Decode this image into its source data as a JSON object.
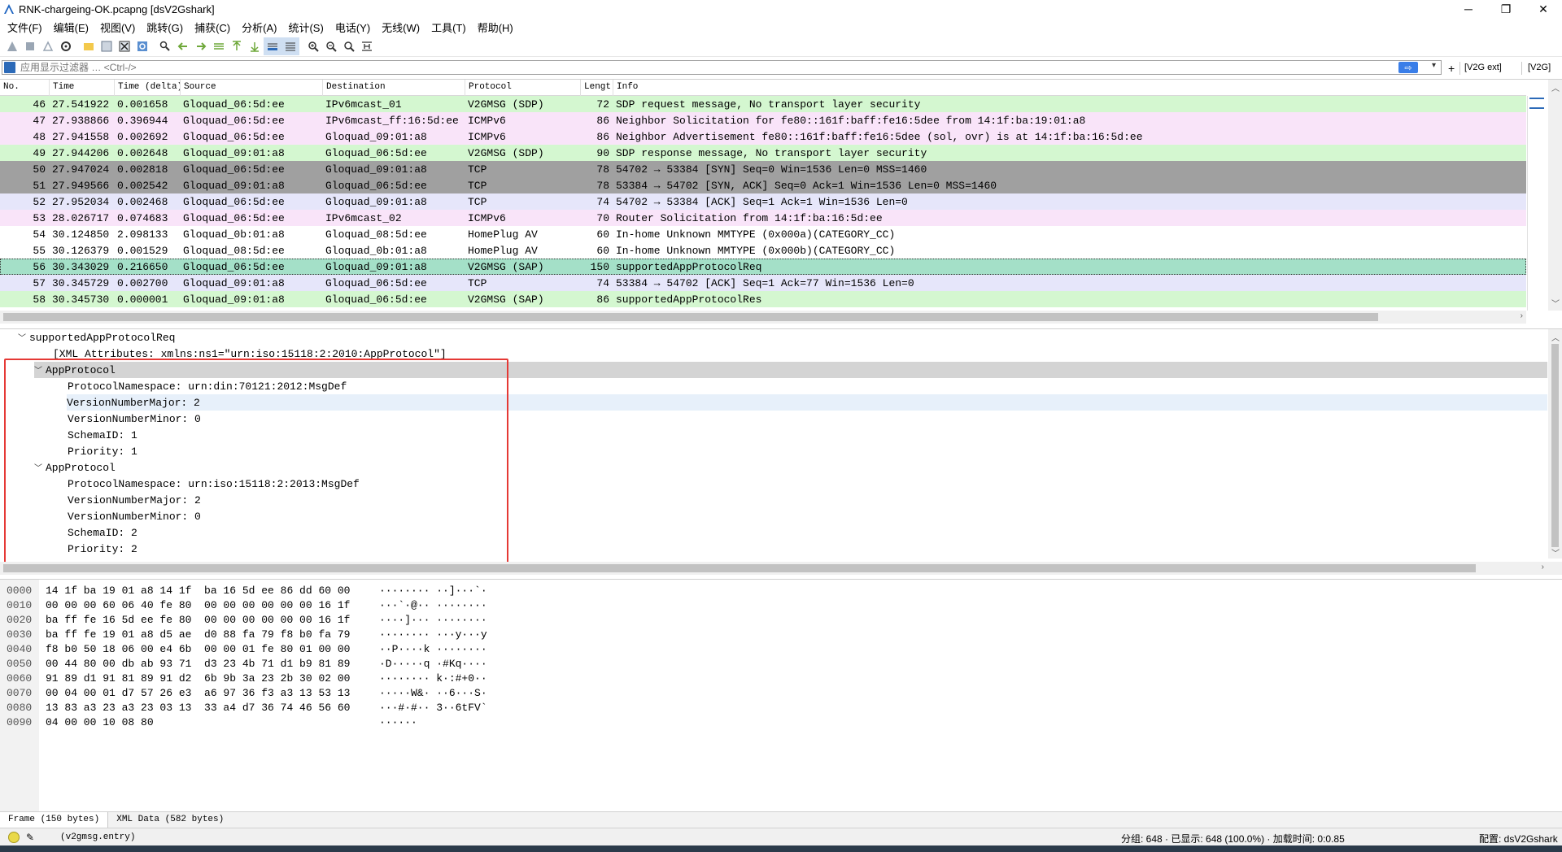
{
  "window": {
    "title": "RNK-chargeing-OK.pcapng [dsV2Gshark]",
    "controls": {
      "minimize": "─",
      "maximize": "❐",
      "close": "✕"
    }
  },
  "menu": [
    "文件(F)",
    "编辑(E)",
    "视图(V)",
    "跳转(G)",
    "捕获(C)",
    "分析(A)",
    "统计(S)",
    "电话(Y)",
    "无线(W)",
    "工具(T)",
    "帮助(H)"
  ],
  "toolbar": {
    "icons": [
      "shark-fin-start-icon",
      "stop-icon",
      "restart-icon",
      "options-gear-icon",
      "open-folder-icon",
      "save-icon",
      "close-file-icon",
      "reload-icon",
      "find-icon",
      "go-back-icon",
      "go-forward-icon",
      "go-to-packet-icon",
      "first-packet-icon",
      "last-packet-icon",
      "autoscroll-icon",
      "colorize-icon",
      "zoom-in-icon",
      "zoom-out-icon",
      "zoom-reset-icon",
      "resize-columns-icon"
    ]
  },
  "filter": {
    "placeholder": "应用显示过滤器 … <Ctrl-/>",
    "apply_icon": "arrow-right-icon",
    "plus": "+",
    "buttons": [
      "[V2G ext]",
      "[V2G]"
    ]
  },
  "packet_list": {
    "columns": [
      "No.",
      "Time",
      "Time (delta)",
      "Source",
      "Destination",
      "Protocol",
      "Lengt!",
      "Info"
    ],
    "rows": [
      {
        "no": "46",
        "time": "27.541922",
        "delta": "0.001658",
        "src": "Gloquad_06:5d:ee",
        "dst": "IPv6mcast_01",
        "proto": "V2GMSG (SDP)",
        "len": "72",
        "info": "SDP request message, No transport layer security",
        "bg": "#d4f7d0"
      },
      {
        "no": "47",
        "time": "27.938866",
        "delta": "0.396944",
        "src": "Gloquad_06:5d:ee",
        "dst": "IPv6mcast_ff:16:5d:ee",
        "proto": "ICMPv6",
        "len": "86",
        "info": "Neighbor Solicitation for fe80::161f:baff:fe16:5dee from 14:1f:ba:19:01:a8",
        "bg": "#f9e4f9"
      },
      {
        "no": "48",
        "time": "27.941558",
        "delta": "0.002692",
        "src": "Gloquad_06:5d:ee",
        "dst": "Gloquad_09:01:a8",
        "proto": "ICMPv6",
        "len": "86",
        "info": "Neighbor Advertisement fe80::161f:baff:fe16:5dee (sol, ovr) is at 14:1f:ba:16:5d:ee",
        "bg": "#f9e4f9"
      },
      {
        "no": "49",
        "time": "27.944206",
        "delta": "0.002648",
        "src": "Gloquad_09:01:a8",
        "dst": "Gloquad_06:5d:ee",
        "proto": "V2GMSG (SDP)",
        "len": "90",
        "info": "SDP response message, No transport layer security",
        "bg": "#d4f7d0"
      },
      {
        "no": "50",
        "time": "27.947024",
        "delta": "0.002818",
        "src": "Gloquad_06:5d:ee",
        "dst": "Gloquad_09:01:a8",
        "proto": "TCP",
        "len": "78",
        "info": "54702 → 53384 [SYN] Seq=0 Win=1536 Len=0 MSS=1460",
        "bg": "#a0a0a0"
      },
      {
        "no": "51",
        "time": "27.949566",
        "delta": "0.002542",
        "src": "Gloquad_09:01:a8",
        "dst": "Gloquad_06:5d:ee",
        "proto": "TCP",
        "len": "78",
        "info": "53384 → 54702 [SYN, ACK] Seq=0 Ack=1 Win=1536 Len=0 MSS=1460",
        "bg": "#a0a0a0"
      },
      {
        "no": "52",
        "time": "27.952034",
        "delta": "0.002468",
        "src": "Gloquad_06:5d:ee",
        "dst": "Gloquad_09:01:a8",
        "proto": "TCP",
        "len": "74",
        "info": "54702 → 53384 [ACK] Seq=1 Ack=1 Win=1536 Len=0",
        "bg": "#e6e6fa"
      },
      {
        "no": "53",
        "time": "28.026717",
        "delta": "0.074683",
        "src": "Gloquad_06:5d:ee",
        "dst": "IPv6mcast_02",
        "proto": "ICMPv6",
        "len": "70",
        "info": "Router Solicitation from 14:1f:ba:16:5d:ee",
        "bg": "#f9e4f9"
      },
      {
        "no": "54",
        "time": "30.124850",
        "delta": "2.098133",
        "src": "Gloquad_0b:01:a8",
        "dst": "Gloquad_08:5d:ee",
        "proto": "HomePlug AV",
        "len": "60",
        "info": "In-home Unknown MMTYPE (0x000a)(CATEGORY_CC)",
        "bg": "#ffffff"
      },
      {
        "no": "55",
        "time": "30.126379",
        "delta": "0.001529",
        "src": "Gloquad_08:5d:ee",
        "dst": "Gloquad_0b:01:a8",
        "proto": "HomePlug AV",
        "len": "60",
        "info": "In-home Unknown MMTYPE (0x000b)(CATEGORY_CC)",
        "bg": "#ffffff"
      },
      {
        "no": "56",
        "time": "30.343029",
        "delta": "0.216650",
        "src": "Gloquad_06:5d:ee",
        "dst": "Gloquad_09:01:a8",
        "proto": "V2GMSG (SAP)",
        "len": "150",
        "info": "supportedAppProtocolReq",
        "bg": "#a4e0c8"
      },
      {
        "no": "57",
        "time": "30.345729",
        "delta": "0.002700",
        "src": "Gloquad_09:01:a8",
        "dst": "Gloquad_06:5d:ee",
        "proto": "TCP",
        "len": "74",
        "info": "53384 → 54702 [ACK] Seq=1 Ack=77 Win=1536 Len=0",
        "bg": "#e6e6fa"
      },
      {
        "no": "58",
        "time": "30.345730",
        "delta": "0.000001",
        "src": "Gloquad_09:01:a8",
        "dst": "Gloquad_06:5d:ee",
        "proto": "V2GMSG (SAP)",
        "len": "86",
        "info": "supportedAppProtocolRes",
        "bg": "#d4f7d0"
      }
    ],
    "selected_row_no": "56"
  },
  "details": {
    "root": "supportedAppProtocolReq",
    "xml_attr": "[XML Attributes:  xmlns:ns1=\"urn:iso:15118:2:2010:AppProtocol\"]",
    "groups": [
      {
        "label": "AppProtocol",
        "fields": [
          "ProtocolNamespace: urn:din:70121:2012:MsgDef",
          "VersionNumberMajor: 2",
          "VersionNumberMinor: 0",
          "SchemaID: 1",
          "Priority: 1"
        ]
      },
      {
        "label": "AppProtocol",
        "fields": [
          "ProtocolNamespace: urn:iso:15118:2:2013:MsgDef",
          "VersionNumberMajor: 2",
          "VersionNumberMinor: 0",
          "SchemaID: 2",
          "Priority: 2"
        ]
      }
    ]
  },
  "bytes": {
    "rows": [
      {
        "off": "0000",
        "hex": "14 1f ba 19 01 a8 14 1f  ba 16 5d ee 86 dd 60 00",
        "ascii": "········ ··]···`·"
      },
      {
        "off": "0010",
        "hex": "00 00 00 60 06 40 fe 80  00 00 00 00 00 00 16 1f",
        "ascii": "···`·@·· ········"
      },
      {
        "off": "0020",
        "hex": "ba ff fe 16 5d ee fe 80  00 00 00 00 00 00 16 1f",
        "ascii": "····]··· ········"
      },
      {
        "off": "0030",
        "hex": "ba ff fe 19 01 a8 d5 ae  d0 88 fa 79 f8 b0 fa 79",
        "ascii": "········ ···y···y"
      },
      {
        "off": "0040",
        "hex": "f8 b0 50 18 06 00 e4 6b  00 00 01 fe 80 01 00 00",
        "ascii": "··P····k ········"
      },
      {
        "off": "0050",
        "hex": "00 44 80 00 db ab 93 71  d3 23 4b 71 d1 b9 81 89",
        "ascii": "·D·····q ·#Kq····"
      },
      {
        "off": "0060",
        "hex": "91 89 d1 91 81 89 91 d2  6b 9b 3a 23 2b 30 02 00",
        "ascii": "········ k·:#+0··"
      },
      {
        "off": "0070",
        "hex": "00 04 00 01 d7 57 26 e3  a6 97 36 f3 a3 13 53 13",
        "ascii": "·····W&· ··6···S·"
      },
      {
        "off": "0080",
        "hex": "13 83 a3 23 a3 23 03 13  33 a4 d7 36 74 46 56 60",
        "ascii": "···#·#·· 3··6tFV`"
      },
      {
        "off": "0090",
        "hex": "04 00 00 10 08 80",
        "ascii": "······"
      }
    ],
    "tabs": [
      "Frame (150 bytes)",
      "XML Data (582 bytes)"
    ]
  },
  "status": {
    "field": "(v2gmsg.entry)",
    "stats": "分组: 648 · 已显示: 648 (100.0%) · 加载时间: 0:0.85",
    "profile": "配置: dsV2Gshark"
  }
}
